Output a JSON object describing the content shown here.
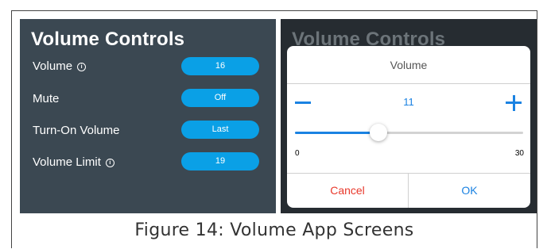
{
  "left_screen": {
    "title": "Volume Controls",
    "rows": [
      {
        "label": "Volume",
        "value": "16",
        "has_info": true
      },
      {
        "label": "Mute",
        "value": "Off",
        "has_info": false
      },
      {
        "label": "Turn-On Volume",
        "value": "Last",
        "has_info": false
      },
      {
        "label": "Volume Limit",
        "value": "19",
        "has_info": true
      }
    ]
  },
  "right_screen": {
    "title": "Volume Controls",
    "dialog": {
      "title": "Volume",
      "value": "11",
      "slider_min": "0",
      "slider_max": "30",
      "cancel_label": "Cancel",
      "ok_label": "OK"
    }
  },
  "caption": "Figure 14: Volume App Screens",
  "colors": {
    "accent": "#0aa0e6",
    "dialog_accent": "#1a82e2",
    "cancel": "#e8382b",
    "panel_bg": "#3b4852"
  }
}
